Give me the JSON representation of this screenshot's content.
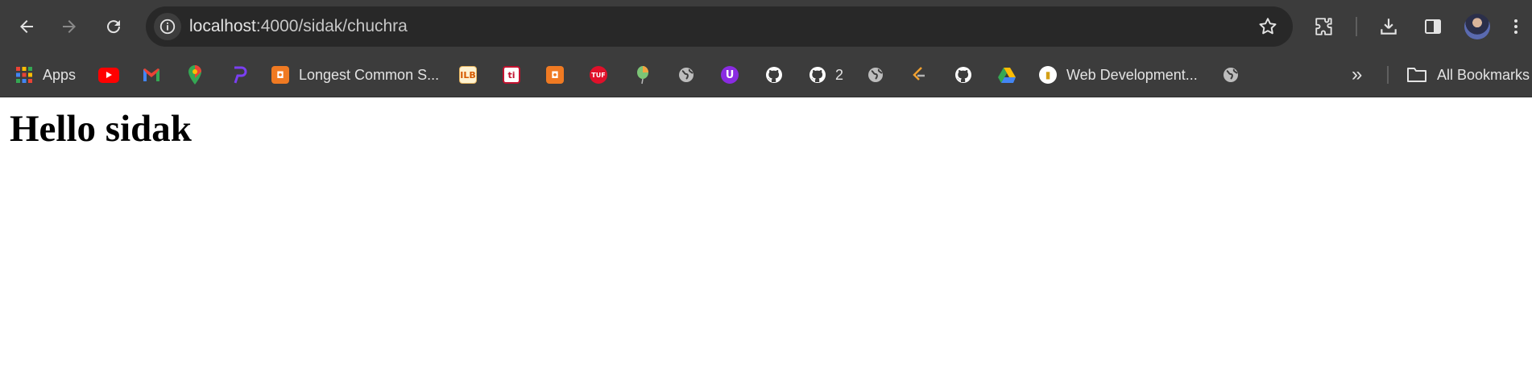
{
  "browser": {
    "address_bar": {
      "host": "localhost",
      "path": ":4000/sidak/chuchra"
    },
    "bookmarks": {
      "apps_label": "Apps",
      "items": [
        {
          "icon": "youtube-icon",
          "label": ""
        },
        {
          "icon": "gmail-icon",
          "label": ""
        },
        {
          "icon": "maps-icon",
          "label": ""
        },
        {
          "icon": "power-icon",
          "label": ""
        },
        {
          "icon": "codingninjas-icon",
          "label": "Longest Common S..."
        },
        {
          "icon": "ilb-icon",
          "label": ""
        },
        {
          "icon": "ti-icon",
          "label": ""
        },
        {
          "icon": "codingninjas-icon-2",
          "label": ""
        },
        {
          "icon": "tuf-icon",
          "label": ""
        },
        {
          "icon": "balloon-icon",
          "label": ""
        },
        {
          "icon": "globe-icon",
          "label": ""
        },
        {
          "icon": "u-icon",
          "label": ""
        },
        {
          "icon": "github-icon",
          "label": ""
        },
        {
          "icon": "github-icon-2",
          "label": "2"
        },
        {
          "icon": "globe-icon-2",
          "label": ""
        },
        {
          "icon": "leetcode-icon",
          "label": ""
        },
        {
          "icon": "github-icon-3",
          "label": ""
        },
        {
          "icon": "drive-icon",
          "label": ""
        },
        {
          "icon": "webdev-icon",
          "label": "Web Development..."
        },
        {
          "icon": "globe-icon-3",
          "label": ""
        }
      ],
      "overflow_label": "»",
      "all_bookmarks_label": "All Bookmarks"
    }
  },
  "page": {
    "heading": "Hello sidak"
  },
  "colors": {
    "toolbar_bg": "#3c3c3c",
    "omnibox_bg": "#282828",
    "text": "#e3e3e3",
    "page_bg": "#ffffff"
  }
}
